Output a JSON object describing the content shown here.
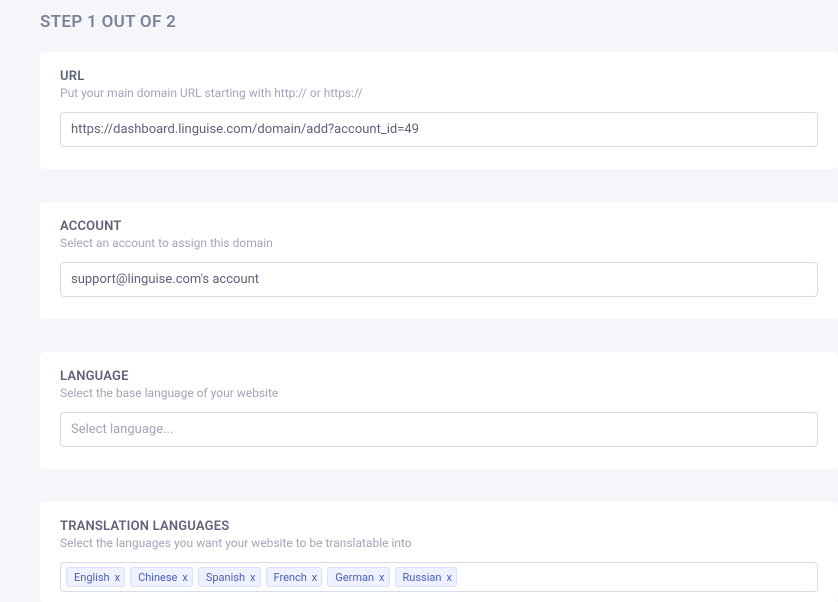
{
  "page_title": "STEP 1 OUT OF 2",
  "url_section": {
    "label": "URL",
    "desc": "Put your main domain URL starting with http:// or https://",
    "value": "https://dashboard.linguise.com/domain/add?account_id=49"
  },
  "account_section": {
    "label": "ACCOUNT",
    "desc": "Select an account to assign this domain",
    "value": "support@linguise.com's account"
  },
  "language_section": {
    "label": "LANGUAGE",
    "desc": "Select the base language of your website",
    "placeholder": "Select language..."
  },
  "translation_section": {
    "label": "TRANSLATION LANGUAGES",
    "desc": "Select the languages you want your website to be translatable into",
    "tags": [
      "English",
      "Chinese",
      "Spanish",
      "French",
      "German",
      "Russian"
    ]
  }
}
